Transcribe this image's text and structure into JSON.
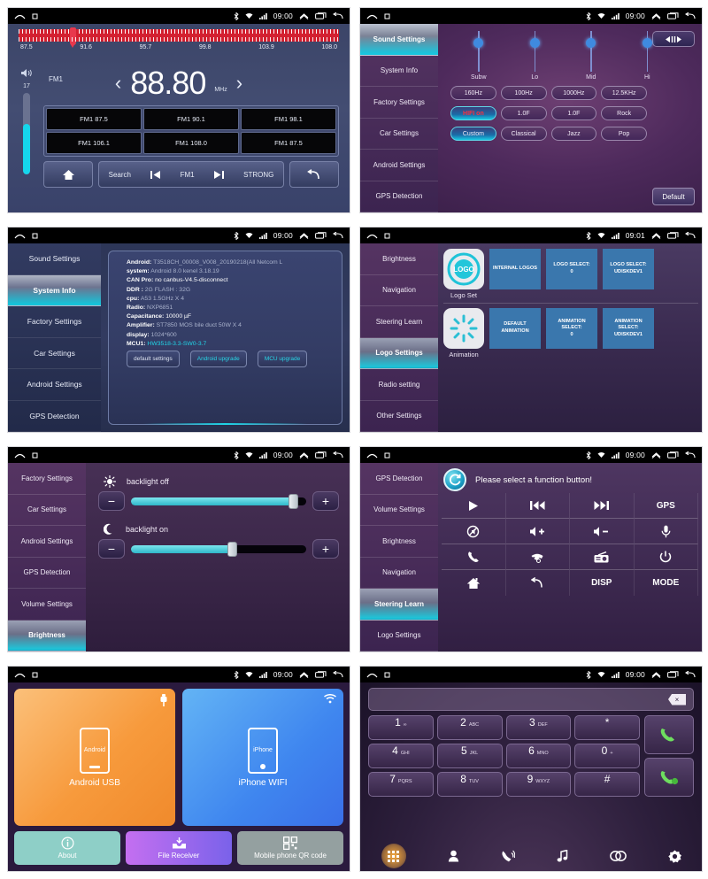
{
  "statusbar": {
    "time_0900": "09:00",
    "time_0901": "09:01"
  },
  "radio": {
    "scale_labels": [
      "87.5",
      "91.6",
      "95.7",
      "99.8",
      "103.9",
      "108.0"
    ],
    "volume_value": "17",
    "band_tag": "FM1",
    "frequency": "88.80",
    "unit": "MHz",
    "prev_arrow": "‹",
    "next_arrow": "›",
    "presets": [
      "FM1 87.5",
      "FM1 90.1",
      "FM1 98.1",
      "FM1 106.1",
      "FM1 108.0",
      "FM1 87.5"
    ],
    "controls": {
      "search": "Search",
      "band": "FM1",
      "strong": "STRONG"
    }
  },
  "sound": {
    "sidebar": [
      "Sound Settings",
      "System Info",
      "Factory Settings",
      "Car Settings",
      "Android Settings",
      "GPS Detection"
    ],
    "active": "Sound Settings",
    "sliders": [
      {
        "label": "Subw",
        "pos": 18
      },
      {
        "label": "Lo",
        "pos": 18
      },
      {
        "label": "Mid",
        "pos": 18
      },
      {
        "label": "Hi",
        "pos": 18
      }
    ],
    "row_freq": [
      "160Hz",
      "100Hz",
      "1000Hz",
      "12.5KHz"
    ],
    "row_mid": [
      "HIFI on",
      "1.0F",
      "1.0F",
      "Rock"
    ],
    "row_presets": [
      "Custom",
      "Classical",
      "Jazz",
      "Pop"
    ],
    "default_label": "Default",
    "accent": "#19c8e2"
  },
  "sysinfo": {
    "sidebar": [
      "Sound Settings",
      "System Info",
      "Factory Settings",
      "Car Settings",
      "Android Settings",
      "GPS Detection"
    ],
    "active": "System Info",
    "lines": [
      {
        "key": "Android:",
        "val": "T3518CH_00008_V008_20190218(All Netcom L"
      },
      {
        "key": "system:",
        "val": "Android 8.0    kenel  3.18.19"
      },
      {
        "key": "CAN Pro:",
        "val": "no canbus-V4.5-disconnect"
      },
      {
        "key": "DDR :",
        "val": "2G      FLASH :   32G"
      },
      {
        "key": "cpu:",
        "val": "A53 1.5GHz X 4"
      },
      {
        "key": "Radio:",
        "val": "NXP6851"
      },
      {
        "key": "Capacitance:",
        "val": "10000 µF"
      },
      {
        "key": "Amplifier:",
        "val": "ST7850 MOS bile duct 50W X 4"
      },
      {
        "key": "display:",
        "val": "1024*600"
      },
      {
        "key": "MCU1:",
        "val": "HW3518-3.3-SW0-3.7"
      }
    ],
    "buttons": [
      "default settings",
      "Android upgrade",
      "MCU upgrade"
    ]
  },
  "logo": {
    "sidebar": [
      "Brightness",
      "Navigation",
      "Steering Learn",
      "Logo Settings",
      "Radio setting",
      "Other Settings"
    ],
    "active": "Logo Settings",
    "row1": {
      "caption": "Logo Set",
      "thumb_text": "LOGO",
      "tiles": [
        "INTERNAL LOGOS",
        "LOGO SELECT:\n0",
        "LOGO SELECT:\nUDISKDEV1"
      ]
    },
    "row2": {
      "caption": "Animation",
      "tiles": [
        "DEFAULT\nANIMATION",
        "ANIMATION\nSELECT:\n0",
        "ANIMATION\nSELECT:\nUDISKDEV1"
      ]
    },
    "tile_color": "#3a77ad"
  },
  "brightness": {
    "sidebar": [
      "Factory Settings",
      "Car Settings",
      "Android Settings",
      "GPS Detection",
      "Volume Settings",
      "Brightness"
    ],
    "active": "Brightness",
    "rows": [
      {
        "icon": "sun-icon",
        "label": "backlight off",
        "value": 93,
        "minus": "−",
        "plus": "+"
      },
      {
        "icon": "moon-icon",
        "label": "backlight on",
        "value": 58,
        "minus": "−",
        "plus": "+"
      }
    ]
  },
  "steering": {
    "sidebar": [
      "GPS Detection",
      "Volume Settings",
      "Brightness",
      "Navigation",
      "Steering Learn",
      "Logo Settings"
    ],
    "active": "Steering Learn",
    "title": "Please select a function button!",
    "buttons": [
      {
        "name": "play-icon",
        "glyph": "▶"
      },
      {
        "name": "previous-track-icon",
        "glyph": "⏮"
      },
      {
        "name": "next-track-icon",
        "glyph": "⏭"
      },
      {
        "name": "gps-label",
        "glyph": "GPS"
      },
      {
        "name": "mute-icon",
        "glyph": "⌀"
      },
      {
        "name": "volume-up-icon",
        "glyph": "🔊+"
      },
      {
        "name": "volume-down-icon",
        "glyph": "🔊-"
      },
      {
        "name": "microphone-icon",
        "glyph": "🎤"
      },
      {
        "name": "call-answer-icon",
        "glyph": "☎"
      },
      {
        "name": "call-end-icon",
        "glyph": "✆"
      },
      {
        "name": "radio-icon",
        "glyph": "📻"
      },
      {
        "name": "power-icon",
        "glyph": "⏻"
      },
      {
        "name": "home-icon",
        "glyph": "🏠"
      },
      {
        "name": "back-icon",
        "glyph": "↶"
      },
      {
        "name": "disp-label",
        "glyph": "DISP"
      },
      {
        "name": "mode-label",
        "glyph": "MODE"
      }
    ]
  },
  "phonelink": {
    "android": {
      "title": "Android USB",
      "phone_text": "Android",
      "corner_icon": "usb-icon"
    },
    "iphone": {
      "title": "iPhone WIFI",
      "phone_text": "iPhone",
      "corner_icon": "wifi-icon"
    },
    "buttons": [
      {
        "label": "About",
        "icon": "info-icon"
      },
      {
        "label": "File Receiver",
        "icon": "download-box-icon"
      },
      {
        "label": "Mobile phone QR code",
        "icon": "qr-code-icon"
      }
    ]
  },
  "dialer": {
    "input_value": "",
    "delete_glyph": "×",
    "keys": [
      {
        "d": "1",
        "l": "∞"
      },
      {
        "d": "2",
        "l": "ABC"
      },
      {
        "d": "3",
        "l": "DEF"
      },
      {
        "d": "*",
        "l": ""
      },
      {
        "d": "4",
        "l": "GHI"
      },
      {
        "d": "5",
        "l": "JKL"
      },
      {
        "d": "6",
        "l": "MNO"
      },
      {
        "d": "0",
        "l": "+"
      },
      {
        "d": "7",
        "l": "PQRS"
      },
      {
        "d": "8",
        "l": "TUV"
      },
      {
        "d": "9",
        "l": "WXYZ"
      },
      {
        "d": "#",
        "l": ""
      }
    ],
    "call_glyph": "✆",
    "call2_glyph": "✆",
    "nav": [
      "keypad-icon",
      "contacts-icon",
      "call-log-icon",
      "music-icon",
      "link-icon",
      "settings-icon"
    ]
  }
}
